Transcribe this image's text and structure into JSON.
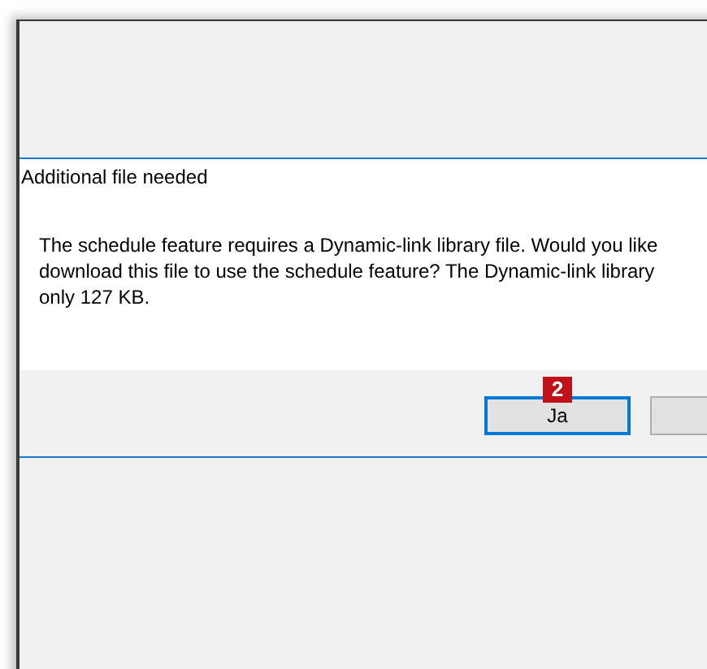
{
  "dialog": {
    "title": "Additional file needed",
    "message_lines": [
      "The schedule feature requires a Dynamic-link library file. Would you like",
      "download this file to use the schedule feature? The Dynamic-link library",
      "only 127 KB."
    ],
    "buttons": [
      {
        "label": "Ja",
        "default": true,
        "badge": "2"
      },
      {
        "default": false
      }
    ]
  }
}
